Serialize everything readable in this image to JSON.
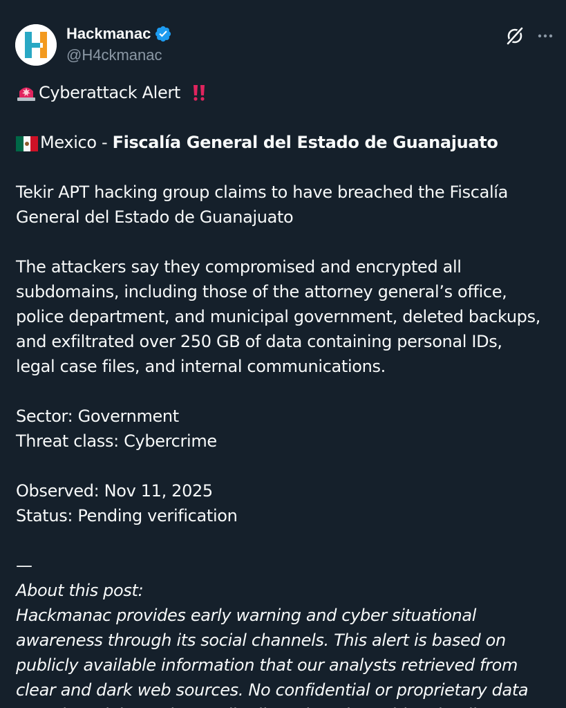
{
  "author": {
    "display_name": "Hackmanac",
    "handle": "@H4ckmanac",
    "verified": true,
    "avatar_icon": "hackmanac-logo"
  },
  "actions": {
    "grok_icon": "grok-icon",
    "more_icon": "more-options-icon"
  },
  "post": {
    "alert_title": "Cyberattack Alert",
    "alert_emoji": "police-light-emoji",
    "alert_suffix_emoji": "double-exclamation-emoji",
    "country_flag": "mexico-flag",
    "country": "Mexico - ",
    "target": "Fiscalía General del Estado de Guanajuato",
    "summary_line1": "Tekir APT hacking group claims to have breached the Fiscalía",
    "summary_line2": "General del Estado de Guanajuato",
    "details_line1": "The attackers say they compromised and encrypted all",
    "details_line2": "subdomains, including those of the attorney general’s office,",
    "details_line3": "police department, and municipal government, deleted backups,",
    "details_line4": "and exfiltrated over 250 GB of data containing personal IDs,",
    "details_line5": "legal case files, and internal communications.",
    "sector": "Sector: Government",
    "threat_class": "Threat class: Cybercrime",
    "observed": "Observed: Nov 11, 2025",
    "status": "Status: Pending verification",
    "separator": "—",
    "about_heading": "About this post:",
    "about_line1": "Hackmanac provides early warning and cyber situational",
    "about_line2": "awareness through its social channels. This alert is based on",
    "about_line3": "publicly available information that our analysts retrieved from",
    "about_line4": "clear and dark web sources. No confidential or proprietary data",
    "about_line5": "was shared, hosted, or redistributed, and sensitive details"
  },
  "colors": {
    "background": "#15202b",
    "text": "#f7f9f9",
    "secondary_text": "#8b98a5",
    "verified_blue": "#1d9bf0",
    "logo_teal": "#29a8c4",
    "logo_orange": "#f39a1f"
  }
}
